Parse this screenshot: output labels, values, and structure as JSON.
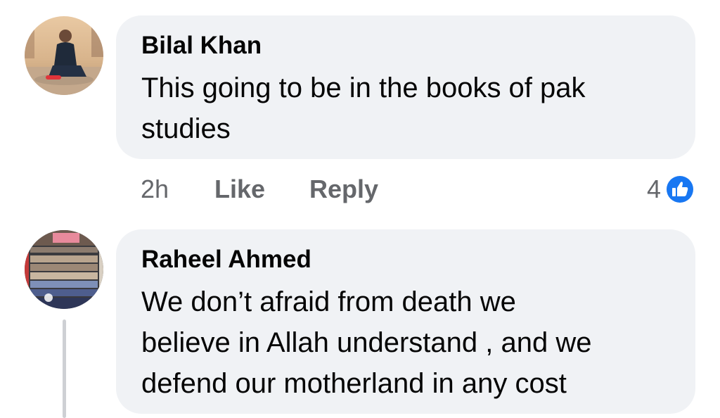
{
  "comments": [
    {
      "author": "Bilal Khan",
      "lines": [
        "This going to be in the books of pak",
        "studies"
      ],
      "time": "2h",
      "like_label": "Like",
      "reply_label": "Reply",
      "reaction_count": "4",
      "reaction_icon": "like-icon"
    },
    {
      "author": "Raheel Ahmed",
      "lines": [
        "We don’t afraid from death we",
        "believe in Allah understand , and we",
        "defend our motherland in any cost"
      ]
    }
  ],
  "colors": {
    "bubble": "#f0f2f5",
    "text": "#050505",
    "meta": "#65676b",
    "like_blue": "#1877f2",
    "thread_line": "#ced0d4"
  }
}
